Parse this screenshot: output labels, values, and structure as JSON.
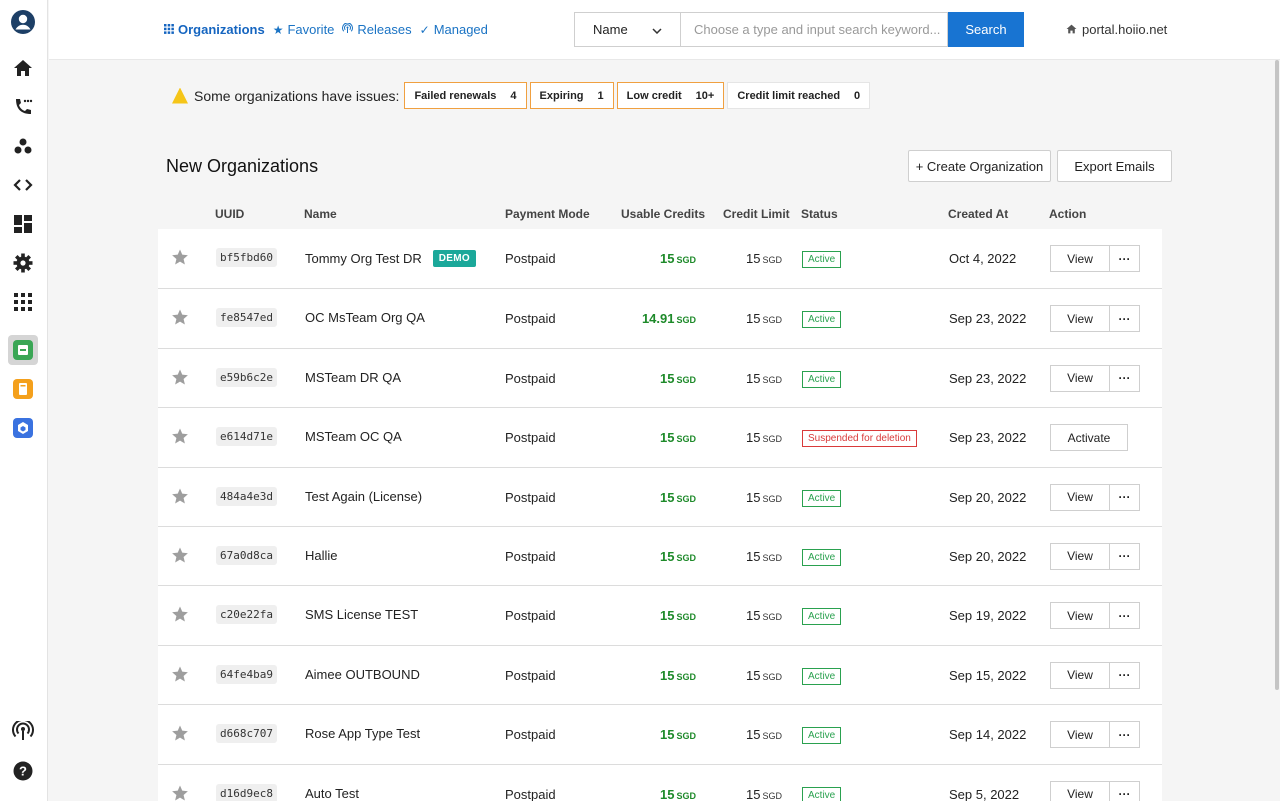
{
  "nav": {
    "organizations": "Organizations",
    "favorite": "Favorite",
    "releases": "Releases",
    "managed": "Managed"
  },
  "search": {
    "field": "Name",
    "placeholder": "Choose a type and input search keyword...",
    "button": "Search"
  },
  "portal": "portal.hoiio.net",
  "issues": {
    "label": "Some organizations have issues:",
    "chips": [
      {
        "label": "Failed renewals",
        "count": "4"
      },
      {
        "label": "Expiring",
        "count": "1"
      },
      {
        "label": "Low credit",
        "count": "10+"
      },
      {
        "label": "Credit limit reached",
        "count": "0"
      }
    ]
  },
  "section": {
    "title": "New Organizations",
    "create_btn": "+ Create Organization",
    "export_btn": "Export Emails"
  },
  "table": {
    "headers": {
      "uuid": "UUID",
      "name": "Name",
      "payment": "Payment Mode",
      "usable": "Usable Credits",
      "limit": "Credit Limit",
      "status": "Status",
      "created": "Created At",
      "action": "Action"
    },
    "rows": [
      {
        "uuid": "bf5fbd60",
        "name": "Tommy Org Test DR",
        "demo": "DEMO",
        "payment": "Postpaid",
        "usable": "15",
        "limit": "15",
        "currency": "SGD",
        "status": "Active",
        "created": "Oct 4, 2022",
        "action": "View"
      },
      {
        "uuid": "fe8547ed",
        "name": "OC MsTeam Org QA",
        "payment": "Postpaid",
        "usable": "14.91",
        "limit": "15",
        "currency": "SGD",
        "status": "Active",
        "created": "Sep 23, 2022",
        "action": "View"
      },
      {
        "uuid": "e59b6c2e",
        "name": "MSTeam DR QA",
        "payment": "Postpaid",
        "usable": "15",
        "limit": "15",
        "currency": "SGD",
        "status": "Active",
        "created": "Sep 23, 2022",
        "action": "View"
      },
      {
        "uuid": "e614d71e",
        "name": "MSTeam OC QA",
        "payment": "Postpaid",
        "usable": "15",
        "limit": "15",
        "currency": "SGD",
        "status": "Suspended for deletion",
        "created": "Sep 23, 2022",
        "action": "Activate"
      },
      {
        "uuid": "484a4e3d",
        "name": "Test Again (License)",
        "payment": "Postpaid",
        "usable": "15",
        "limit": "15",
        "currency": "SGD",
        "status": "Active",
        "created": "Sep 20, 2022",
        "action": "View"
      },
      {
        "uuid": "67a0d8ca",
        "name": "Hallie",
        "payment": "Postpaid",
        "usable": "15",
        "limit": "15",
        "currency": "SGD",
        "status": "Active",
        "created": "Sep 20, 2022",
        "action": "View"
      },
      {
        "uuid": "c20e22fa",
        "name": "SMS License TEST",
        "payment": "Postpaid",
        "usable": "15",
        "limit": "15",
        "currency": "SGD",
        "status": "Active",
        "created": "Sep 19, 2022",
        "action": "View"
      },
      {
        "uuid": "64fe4ba9",
        "name": "Aimee OUTBOUND",
        "payment": "Postpaid",
        "usable": "15",
        "limit": "15",
        "currency": "SGD",
        "status": "Active",
        "created": "Sep 15, 2022",
        "action": "View"
      },
      {
        "uuid": "d668c707",
        "name": "Rose App Type Test",
        "payment": "Postpaid",
        "usable": "15",
        "limit": "15",
        "currency": "SGD",
        "status": "Active",
        "created": "Sep 14, 2022",
        "action": "View"
      },
      {
        "uuid": "d16d9ec8",
        "name": "Auto Test",
        "payment": "Postpaid",
        "usable": "15",
        "limit": "15",
        "currency": "SGD",
        "status": "Active",
        "created": "Sep 5, 2022",
        "action": "View"
      }
    ],
    "more_label": "···"
  },
  "colors": {
    "primary": "#1874d2",
    "credit_green": "#1e8a2a",
    "active_badge": "#2aa14f",
    "suspended_badge": "#d93a3a",
    "demo_badge": "#1ba89a"
  },
  "rail_icons": [
    "user-account-icon",
    "home-icon",
    "phone-routing-icon",
    "group-icon",
    "code-icon",
    "dashboard-icon",
    "settings-gear-icon",
    "apps-grid-icon",
    "app-green-icon",
    "app-orange-icon",
    "app-blue-icon",
    "broadcast-icon",
    "help-icon"
  ]
}
